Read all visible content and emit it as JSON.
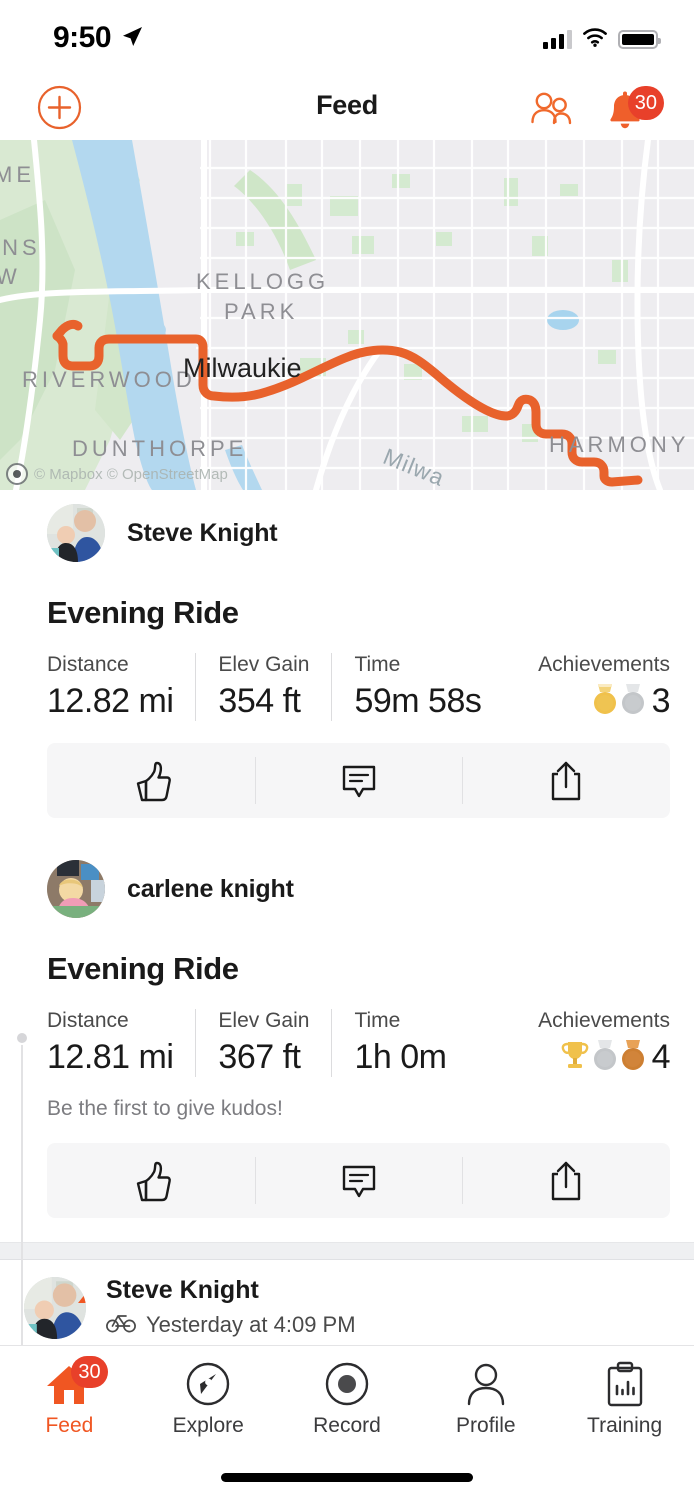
{
  "status_bar": {
    "time": "9:50",
    "location_arrow": "location-arrow-icon",
    "signal": "cellular-signal-icon",
    "wifi": "wifi-icon",
    "battery": "battery-icon"
  },
  "header": {
    "title": "Feed",
    "add_button": "plus-circle-icon",
    "group_button": "group-icon",
    "notifications_button": "bell-icon",
    "notifications_badge": "30"
  },
  "map": {
    "attribution": "© Mapbox © OpenStreetMap",
    "route_color": "#e8622c",
    "labels": [
      {
        "text": "ME",
        "kind": "neighborhood"
      },
      {
        "text": "INS",
        "kind": "neighborhood"
      },
      {
        "text": "W",
        "kind": "neighborhood"
      },
      {
        "text": "KELLOGG",
        "kind": "park"
      },
      {
        "text": "PARK",
        "kind": "park"
      },
      {
        "text": "RIVERWOOD",
        "kind": "neighborhood"
      },
      {
        "text": "Milwaukie",
        "kind": "city"
      },
      {
        "text": "DUNTHORPE",
        "kind": "neighborhood"
      },
      {
        "text": "HARMONY",
        "kind": "neighborhood"
      },
      {
        "text": "Milwa",
        "kind": "river"
      }
    ]
  },
  "activities": [
    {
      "athlete": "Steve Knight",
      "title": "Evening Ride",
      "stats": [
        {
          "label": "Distance",
          "value": "12.82 mi"
        },
        {
          "label": "Elev Gain",
          "value": "354 ft"
        },
        {
          "label": "Time",
          "value": "59m 58s"
        }
      ],
      "achievements_label": "Achievements",
      "achievements_count": "3",
      "achievement_icons": [
        "gold-medal-icon",
        "silver-medal-icon"
      ],
      "kudos_hint": "",
      "actions": [
        "kudos-icon",
        "comment-icon",
        "share-icon"
      ]
    },
    {
      "athlete": "carlene knight",
      "title": "Evening Ride",
      "stats": [
        {
          "label": "Distance",
          "value": "12.81 mi"
        },
        {
          "label": "Elev Gain",
          "value": "367 ft"
        },
        {
          "label": "Time",
          "value": "1h 0m"
        }
      ],
      "achievements_label": "Achievements",
      "achievements_count": "4",
      "achievement_icons": [
        "gold-trophy-icon",
        "silver-medal-icon",
        "bronze-medal-icon"
      ],
      "kudos_hint": "Be the first to give kudos!",
      "actions": [
        "kudos-icon",
        "comment-icon",
        "share-icon"
      ]
    }
  ],
  "next_activity_preview": {
    "athlete": "Steve Knight",
    "sport_icon": "bike-icon",
    "timestamp": "Yesterday at 4:09 PM",
    "badge": "strava-chevron-badge"
  },
  "tabbar": {
    "items": [
      {
        "label": "Feed",
        "icon": "home-icon",
        "active": true,
        "badge": "30"
      },
      {
        "label": "Explore",
        "icon": "compass-icon",
        "active": false,
        "badge": ""
      },
      {
        "label": "Record",
        "icon": "record-icon",
        "active": false,
        "badge": ""
      },
      {
        "label": "Profile",
        "icon": "person-icon",
        "active": false,
        "badge": ""
      },
      {
        "label": "Training",
        "icon": "clipboard-chart-icon",
        "active": false,
        "badge": ""
      }
    ]
  },
  "colors": {
    "brand_orange": "#f05622",
    "badge_red": "#e8402a",
    "gold": "#f0c14b",
    "silver": "#c3c6c9",
    "bronze": "#cd7f32"
  }
}
